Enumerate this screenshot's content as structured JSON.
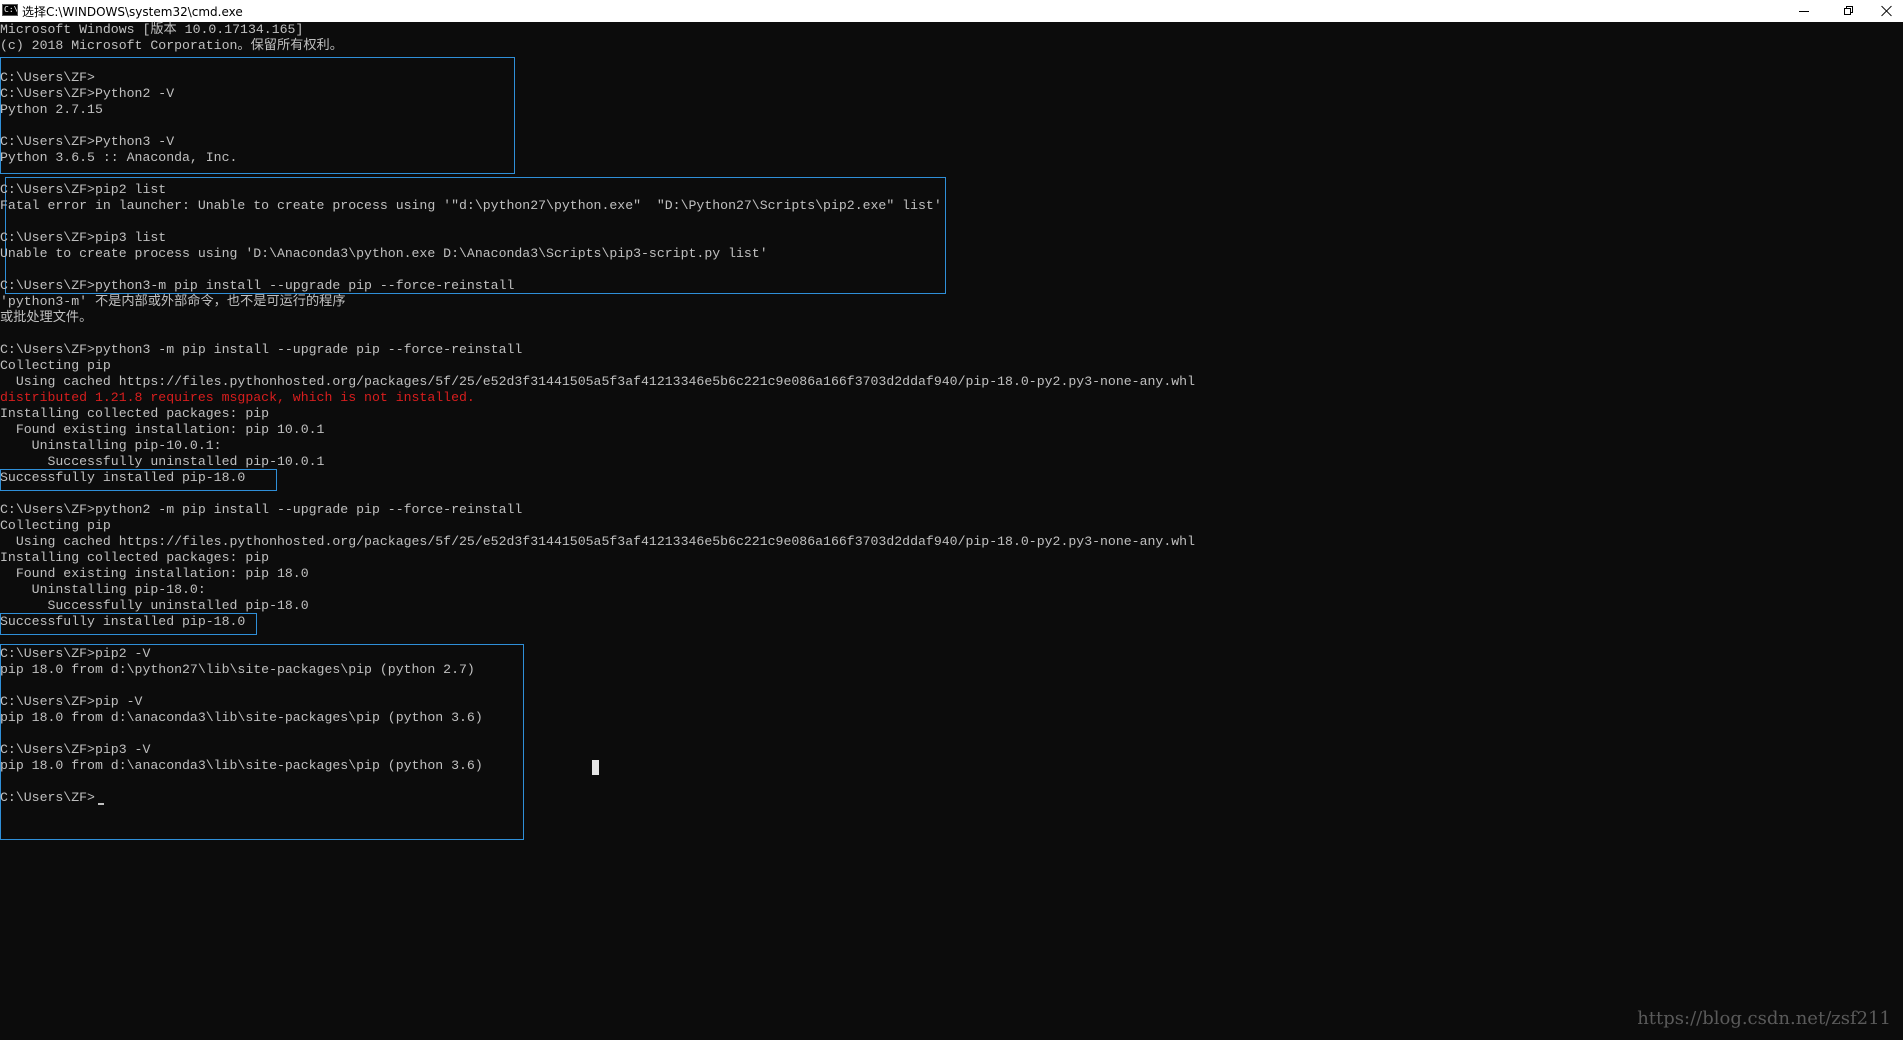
{
  "window": {
    "title": "选择C:\\WINDOWS\\system32\\cmd.exe",
    "icon_text": "C:\\",
    "icon": "cmd-icon"
  },
  "console": {
    "lines": [
      "Microsoft Windows [版本 10.0.17134.165]",
      "(c) 2018 Microsoft Corporation。保留所有权利。",
      "",
      "C:\\Users\\ZF>",
      "C:\\Users\\ZF>Python2 -V",
      "Python 2.7.15",
      "",
      "C:\\Users\\ZF>Python3 -V",
      "Python 3.6.5 :: Anaconda, Inc.",
      "",
      "C:\\Users\\ZF>pip2 list",
      "Fatal error in launcher: Unable to create process using '\"d:\\python27\\python.exe\"  \"D:\\Python27\\Scripts\\pip2.exe\" list'",
      "",
      "C:\\Users\\ZF>pip3 list",
      "Unable to create process using 'D:\\Anaconda3\\python.exe D:\\Anaconda3\\Scripts\\pip3-script.py list'",
      "",
      "C:\\Users\\ZF>python3-m pip install --upgrade pip --force-reinstall",
      "'python3-m' 不是内部或外部命令，也不是可运行的程序",
      "或批处理文件。",
      "",
      "C:\\Users\\ZF>python3 -m pip install --upgrade pip --force-reinstall",
      "Collecting pip",
      "  Using cached https://files.pythonhosted.org/packages/5f/25/e52d3f31441505a5f3af41213346e5b6c221c9e086a166f3703d2ddaf940/pip-18.0-py2.py3-none-any.whl",
      "distributed 1.21.8 requires msgpack, which is not installed.",
      "Installing collected packages: pip",
      "  Found existing installation: pip 10.0.1",
      "    Uninstalling pip-10.0.1:",
      "      Successfully uninstalled pip-10.0.1",
      "Successfully installed pip-18.0",
      "",
      "C:\\Users\\ZF>python2 -m pip install --upgrade pip --force-reinstall",
      "Collecting pip",
      "  Using cached https://files.pythonhosted.org/packages/5f/25/e52d3f31441505a5f3af41213346e5b6c221c9e086a166f3703d2ddaf940/pip-18.0-py2.py3-none-any.whl",
      "Installing collected packages: pip",
      "  Found existing installation: pip 18.0",
      "    Uninstalling pip-18.0:",
      "      Successfully uninstalled pip-18.0",
      "Successfully installed pip-18.0",
      "",
      "C:\\Users\\ZF>pip2 -V",
      "pip 18.0 from d:\\python27\\lib\\site-packages\\pip (python 2.7)",
      "",
      "C:\\Users\\ZF>pip -V",
      "pip 18.0 from d:\\anaconda3\\lib\\site-packages\\pip (python 3.6)",
      "",
      "C:\\Users\\ZF>pip3 -V",
      "pip 18.0 from d:\\anaconda3\\lib\\site-packages\\pip (python 3.6)",
      "",
      "C:\\Users\\ZF>"
    ],
    "error_line_index": 23,
    "text_color": "#c0c0c0",
    "error_color": "#d81e1e",
    "background": "#0c0c0c"
  },
  "annotation_color": "#2f8fd8",
  "watermark": "https://blog.csdn.net/zsf211"
}
